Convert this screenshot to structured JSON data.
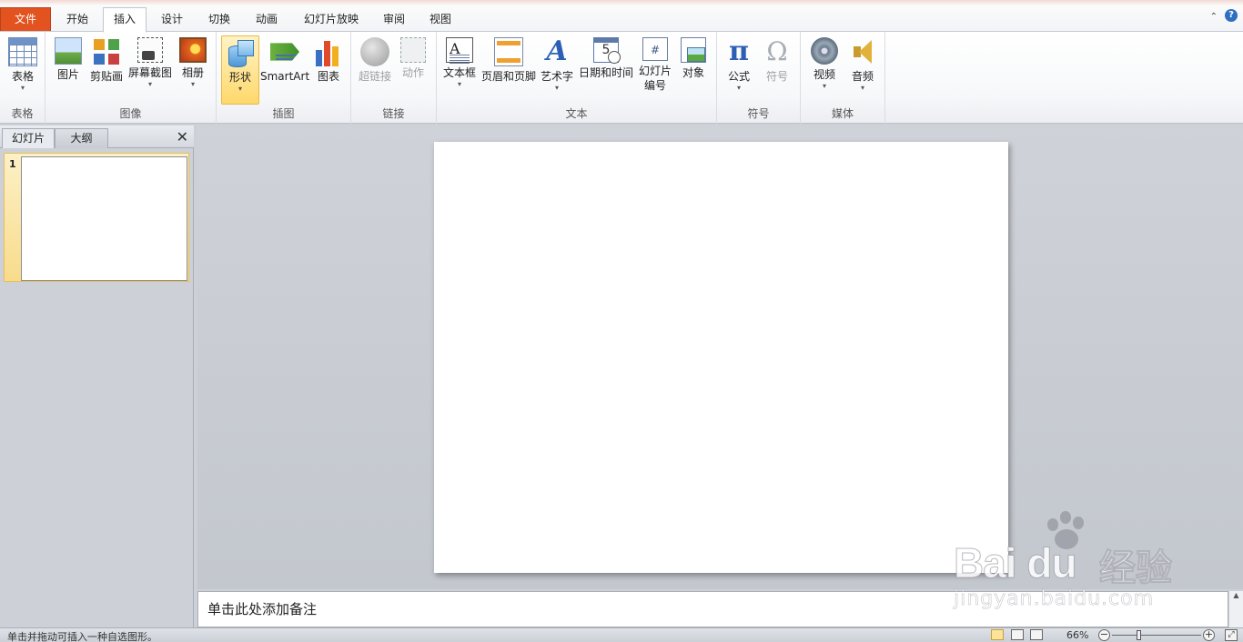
{
  "tabs": [
    "文件",
    "开始",
    "插入",
    "设计",
    "切换",
    "动画",
    "幻灯片放映",
    "审阅",
    "视图"
  ],
  "active_tab": "插入",
  "ribbon": {
    "groups": {
      "table": {
        "label": "表格",
        "buttons": {
          "table": "表格"
        }
      },
      "images": {
        "label": "图像",
        "buttons": {
          "picture": "图片",
          "clipart": "剪贴画",
          "screenshot": "屏幕截图",
          "album": "相册"
        }
      },
      "illustrations": {
        "label": "插图",
        "buttons": {
          "shapes": "形状",
          "smartart": "SmartArt",
          "chart": "图表"
        }
      },
      "links": {
        "label": "链接",
        "buttons": {
          "hyperlink": "超链接",
          "action": "动作"
        }
      },
      "text": {
        "label": "文本",
        "buttons": {
          "textbox": "文本框",
          "header_footer": "页眉和页脚",
          "wordart": "艺术字",
          "datetime": "日期和时间",
          "slide_number_1": "幻灯片",
          "slide_number_2": "编号",
          "object": "对象"
        }
      },
      "symbols": {
        "label": "符号",
        "buttons": {
          "equation": "公式",
          "symbol": "符号"
        }
      },
      "media": {
        "label": "媒体",
        "buttons": {
          "video": "视频",
          "audio": "音频"
        }
      }
    },
    "icon_glyphs": {
      "textbox": "A",
      "datetime": "5",
      "slide_number": "#",
      "pi": "π",
      "omega": "Ω",
      "wordart": "A"
    }
  },
  "left_panel": {
    "tab_slides": "幻灯片",
    "tab_outline": "大纲",
    "close_glyph": "✕",
    "thumb_number": "1"
  },
  "notes": {
    "placeholder": "单击此处添加备注"
  },
  "status": {
    "message": "单击并拖动可插入一种自选图形。",
    "zoom": "66%",
    "zoom_minus": "−",
    "zoom_plus": "+"
  },
  "zoom_percent": 66,
  "watermark": {
    "brand": "Bai du",
    "cn": "经验",
    "url": "jingyan.baidu.com"
  },
  "colors": {
    "file_tab": "#e2531f",
    "highlight": "#ffd86a",
    "accent": "#2d5fb4"
  }
}
